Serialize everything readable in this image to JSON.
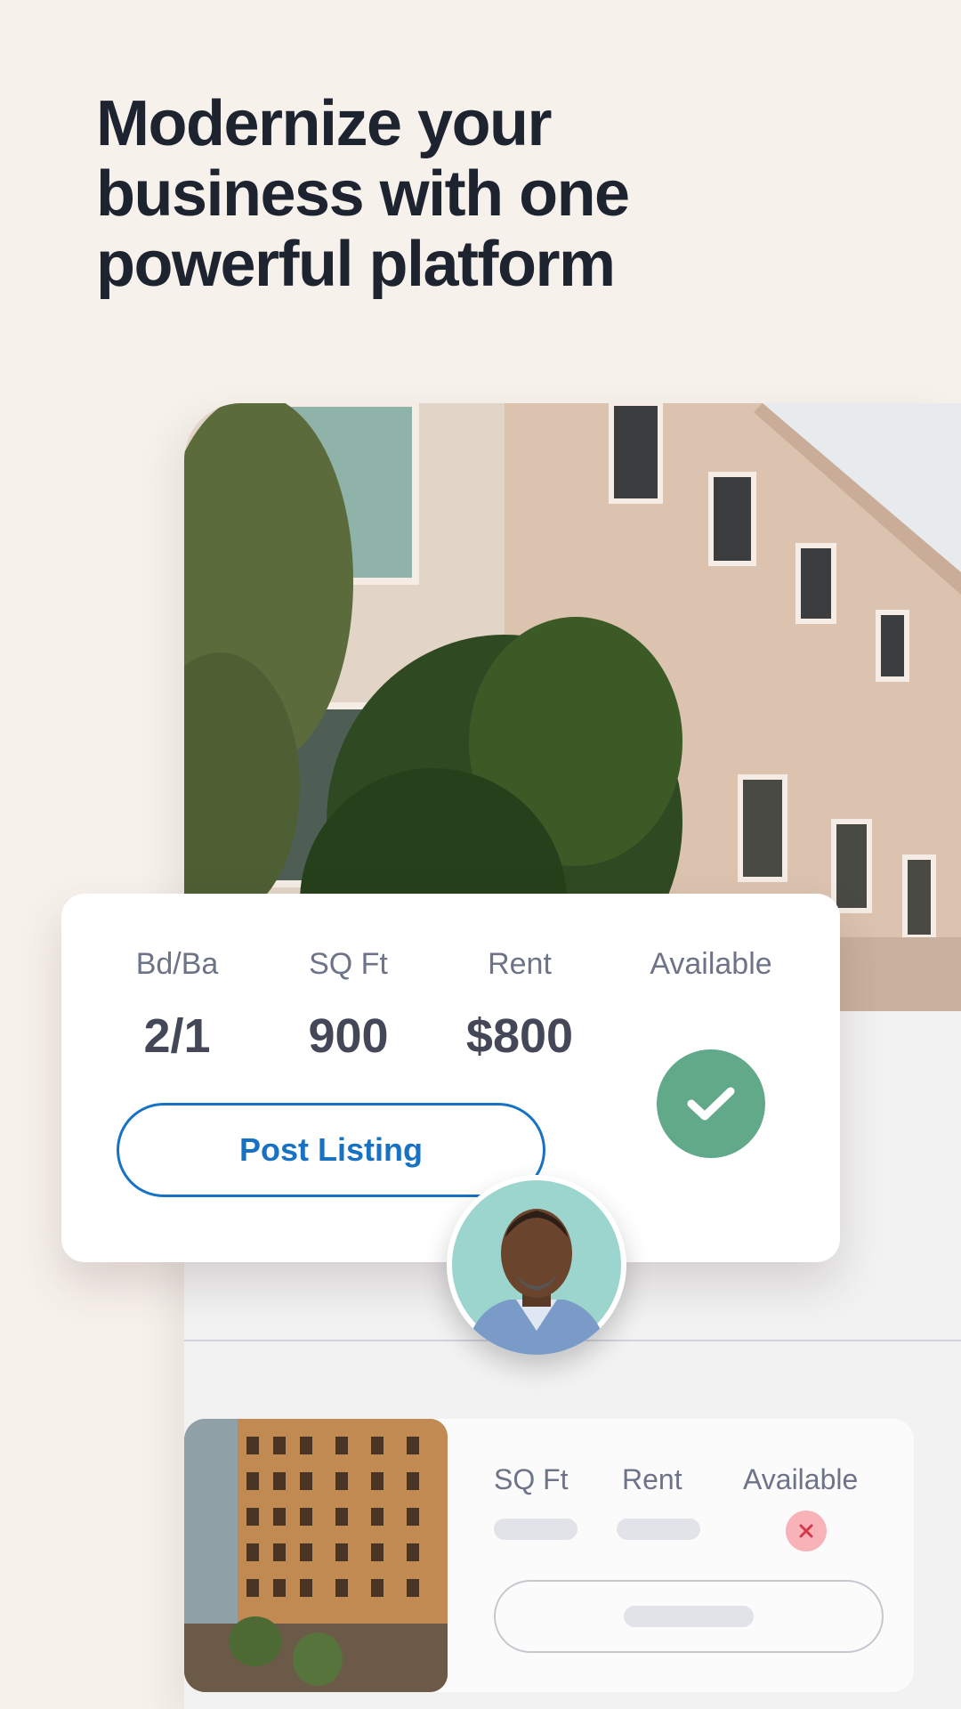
{
  "headline": {
    "line1": "Modernize your",
    "line2": "business with one",
    "line3": "powerful platform"
  },
  "listing": {
    "columns": [
      {
        "label": "Bd/Ba",
        "value": "2/1"
      },
      {
        "label": "SQ Ft",
        "value": "900"
      },
      {
        "label": "Rent",
        "value": "$800"
      },
      {
        "label": "Available",
        "value": ""
      }
    ],
    "post_button": "Post Listing",
    "available_icon": "check-icon",
    "accent_color": "#1872c3",
    "success_color": "#62a98a"
  },
  "secondary_listing": {
    "labels": [
      "SQ Ft",
      "Rent",
      "Available"
    ],
    "available_icon": "close-icon",
    "error_color": "#f7b3b8"
  }
}
